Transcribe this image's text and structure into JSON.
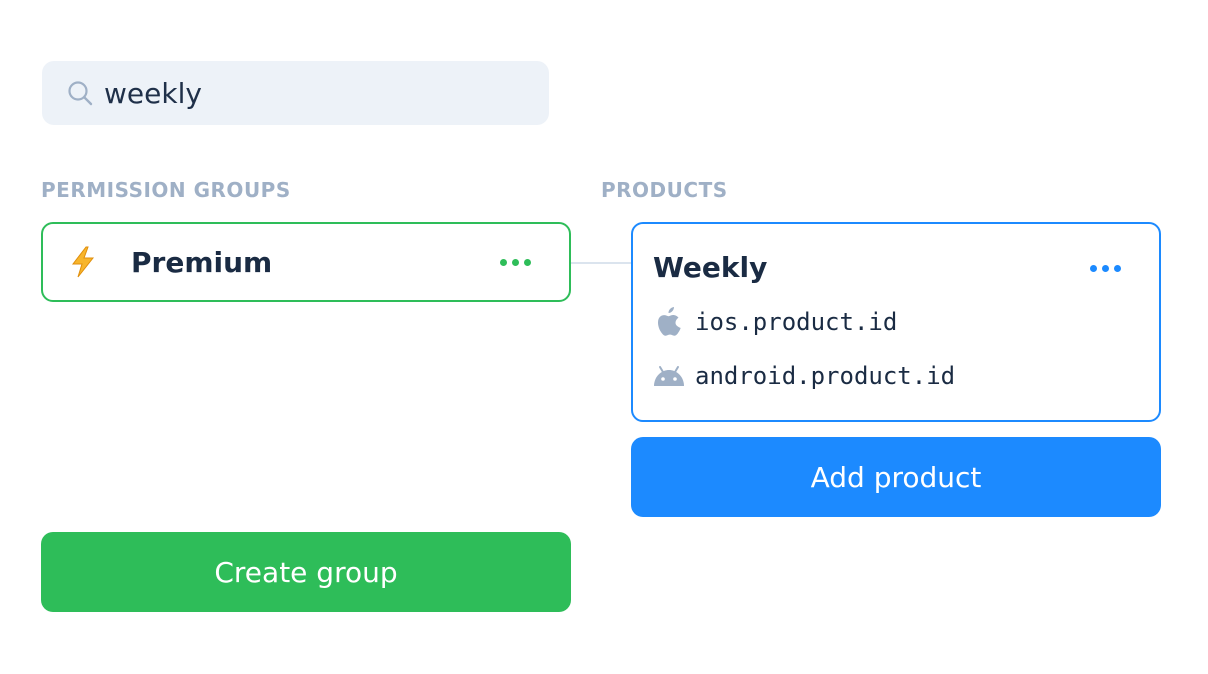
{
  "search": {
    "value": "weekly",
    "icon": "search-icon"
  },
  "groups_section": {
    "label": "PERMISSION GROUPS",
    "groups": [
      {
        "name": "Premium",
        "icon": "lightning-bolt-icon",
        "menu_icon": "more-dots-icon"
      }
    ],
    "create_button_label": "Create group"
  },
  "products_section": {
    "label": "PRODUCTS",
    "products": [
      {
        "name": "Weekly",
        "menu_icon": "more-dots-icon",
        "ios_id": "ios.product.id",
        "android_id": "android.product.id"
      }
    ],
    "add_button_label": "Add product"
  },
  "colors": {
    "green": "#2ebd59",
    "blue": "#1c8aff",
    "label_gray": "#9fb0c6",
    "text_dark": "#1a2b43",
    "search_bg": "#edf2f8"
  }
}
